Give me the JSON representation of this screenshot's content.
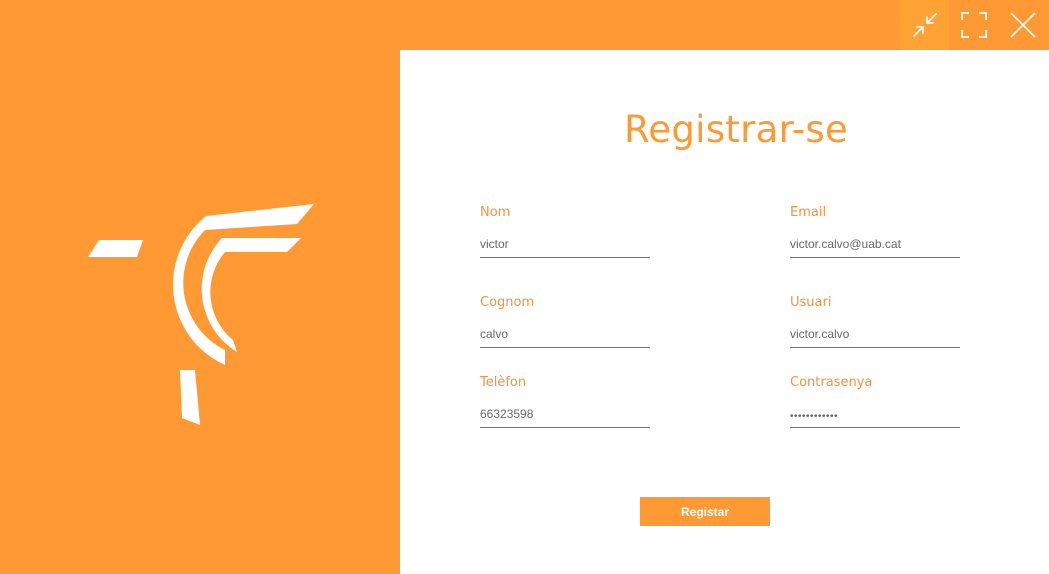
{
  "colors": {
    "accent": "#FF9933",
    "panel": "#FFFFFF",
    "underline": "#4F7F8F"
  },
  "window_controls": {
    "icons": [
      "minimize-arrows-icon",
      "maximize-brackets-icon",
      "close-x-icon"
    ]
  },
  "form": {
    "title": "Registrar-se",
    "fields": {
      "nom": {
        "label": "Nom",
        "value": "victor"
      },
      "email": {
        "label": "Email",
        "value": "victor.calvo@uab.cat"
      },
      "cognom": {
        "label": "Cognom",
        "value": "calvo"
      },
      "usuari": {
        "label": "Usuari",
        "value": "victor.calvo"
      },
      "telefon": {
        "label": "Telèfon",
        "value": "66323598"
      },
      "contrasenya": {
        "label": "Contrasenya",
        "value": "victorcalvo1"
      }
    },
    "submit_label": "Registar"
  }
}
